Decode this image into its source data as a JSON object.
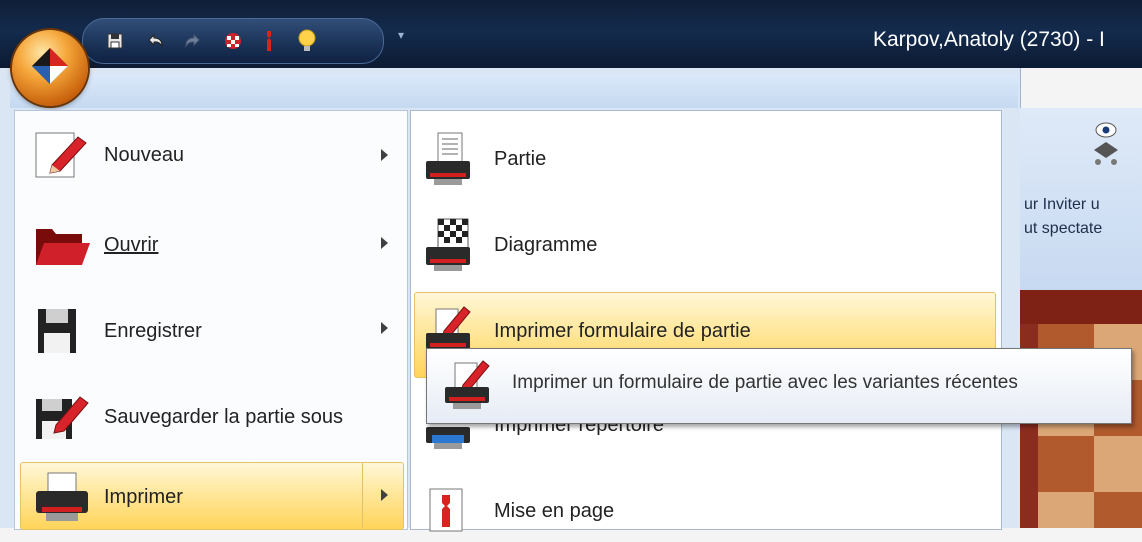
{
  "window": {
    "title": "Karpov,Anatoly (2730) - I"
  },
  "quick_access": {
    "buttons": [
      "save-icon",
      "undo-icon",
      "redo-icon",
      "board-icon",
      "tools-icon",
      "hint-bulb-icon"
    ],
    "more_label": "▾"
  },
  "file_menu": {
    "items": [
      {
        "label": "Nouveau",
        "icon": "new-document-pencil-icon",
        "has_submenu": true
      },
      {
        "label": "Ouvrir",
        "icon": "folder-open-icon",
        "has_submenu": true
      },
      {
        "label": "Enregistrer",
        "icon": "floppy-save-icon",
        "has_submenu": true
      },
      {
        "label": "Sauvegarder la partie sous",
        "icon": "save-as-icon",
        "has_submenu": false
      },
      {
        "label": "Imprimer",
        "icon": "printer-icon",
        "has_submenu": true,
        "selected": true
      }
    ]
  },
  "print_submenu": {
    "items": [
      {
        "label": "Partie",
        "icon": "print-game-icon"
      },
      {
        "label": "Diagramme",
        "icon": "print-diagram-icon"
      },
      {
        "label": "Imprimer formulaire de partie",
        "icon": "print-scoresheet-icon",
        "hovered": true
      },
      {
        "label": "Imprimer répertoire",
        "icon": "print-repertoire-icon"
      },
      {
        "label": "Mise en page",
        "icon": "page-setup-icon"
      }
    ]
  },
  "tooltip": {
    "text": "Imprimer un formulaire de partie avec les variantes récentes"
  },
  "ribbon_partial": {
    "line1": "ur  Inviter u",
    "line2": "ut  spectate"
  }
}
